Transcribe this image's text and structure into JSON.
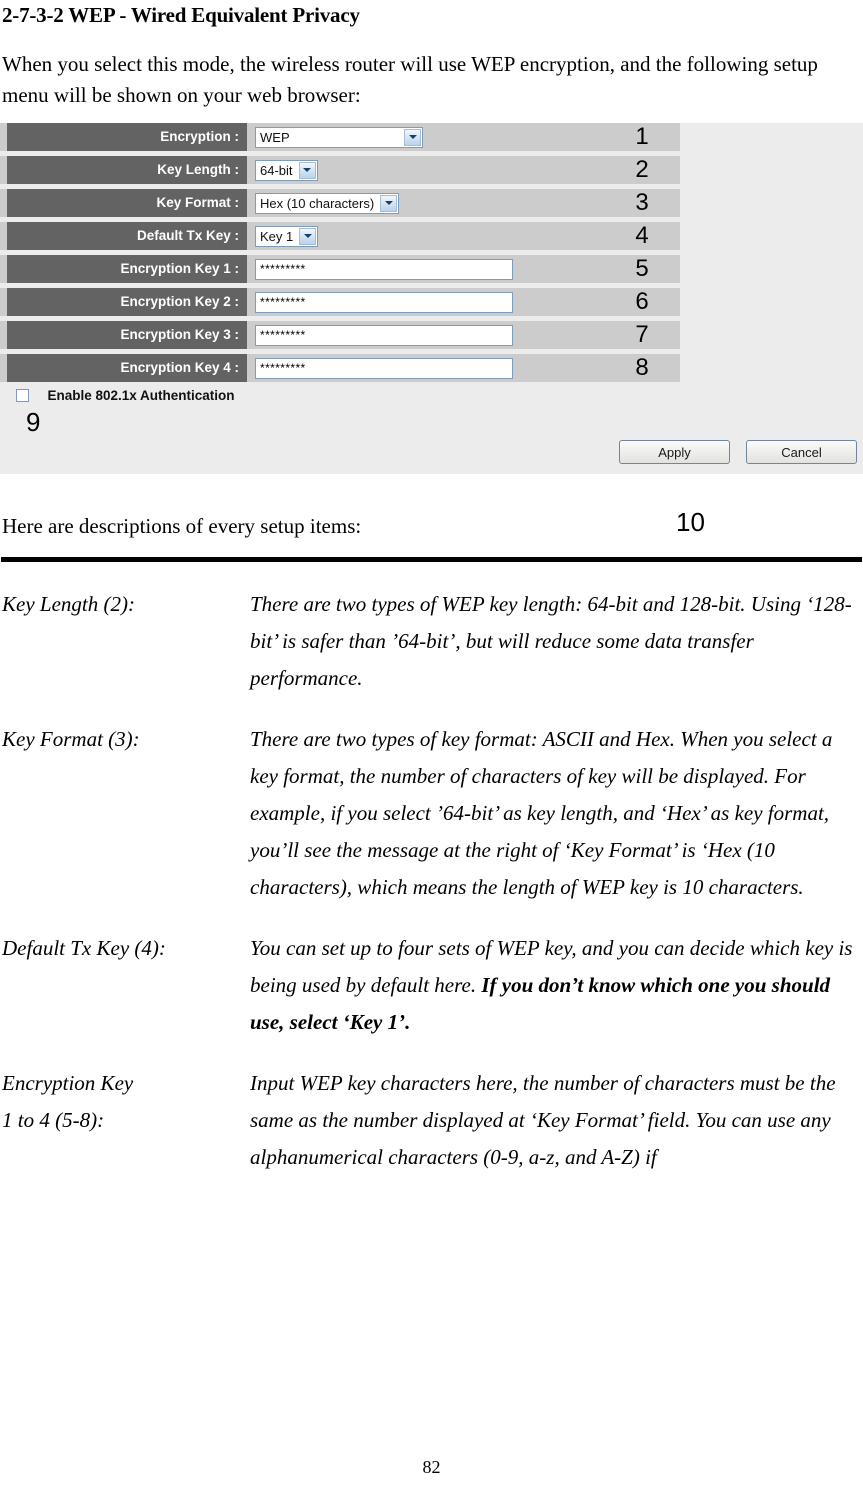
{
  "document": {
    "title": "2-7-3-2 WEP - Wired Equivalent Privacy",
    "intro": "When you select this mode, the wireless router will use WEP encryption, and the following setup menu will be shown on your web browser:",
    "lead_in": "Here are descriptions of every setup items:",
    "page_number": "82"
  },
  "panel": {
    "rows": [
      {
        "label": "Encryption :",
        "control": "select-wide",
        "value": "WEP",
        "callout": "1"
      },
      {
        "label": "Key Length :",
        "control": "select",
        "value": "64-bit",
        "callout": "2"
      },
      {
        "label": "Key Format :",
        "control": "select",
        "value": "Hex (10 characters)",
        "callout": "3"
      },
      {
        "label": "Default Tx Key :",
        "control": "select",
        "value": "Key 1",
        "callout": "4"
      },
      {
        "label": "Encryption Key 1 :",
        "control": "text",
        "value": "*********",
        "callout": "5"
      },
      {
        "label": "Encryption Key 2 :",
        "control": "text",
        "value": "*********",
        "callout": "6"
      },
      {
        "label": "Encryption Key 3 :",
        "control": "text",
        "value": "*********",
        "callout": "7"
      },
      {
        "label": "Encryption Key 4 :",
        "control": "text",
        "value": "*********",
        "callout": "8"
      }
    ],
    "checkbox": {
      "label": "Enable 802.1x Authentication",
      "checked": false,
      "callout": "9"
    },
    "buttons": {
      "apply": "Apply",
      "cancel": "Cancel",
      "callout": "10"
    },
    "colors": {
      "panel_background": "#ececec",
      "row_band": "#cccccc",
      "label_block": "#636363",
      "label_text": "#ffffff",
      "control_border": "#7f9db9"
    }
  },
  "descriptions": [
    {
      "term": "Key Length (2):",
      "body_before": "There are two types of WEP key length: 64-bit and 128-bit. Using ‘128-bit’ is safer than ’64-bit’, but will reduce some data transfer performance.",
      "body_bold": "",
      "body_after": ""
    },
    {
      "term": "Key Format (3):",
      "body_before": "There are two types of key format: ASCII and Hex. When you select a key format, the number of characters of key will be displayed. For example, if you select ’64-bit’ as key length, and ‘Hex’ as key format, you’ll see the message at the right of ‘Key Format’ is ‘Hex (10 characters), which means the length of WEP key is 10 characters.",
      "body_bold": "",
      "body_after": ""
    },
    {
      "term": "Default Tx Key (4):",
      "body_before": "You can set up to four sets of WEP key, and you can decide which key is being used by default here. ",
      "body_bold": "If you don’t know which one you should use, select ‘Key 1’.",
      "body_after": ""
    },
    {
      "term": "Encryption Key\n1 to 4 (5-8):",
      "body_before": "Input WEP key characters here, the number of characters must be the same as the number displayed at ‘Key Format’ field. You can use any alphanumerical characters (0-9, a-z, and A-Z) if",
      "body_bold": "",
      "body_after": ""
    }
  ]
}
